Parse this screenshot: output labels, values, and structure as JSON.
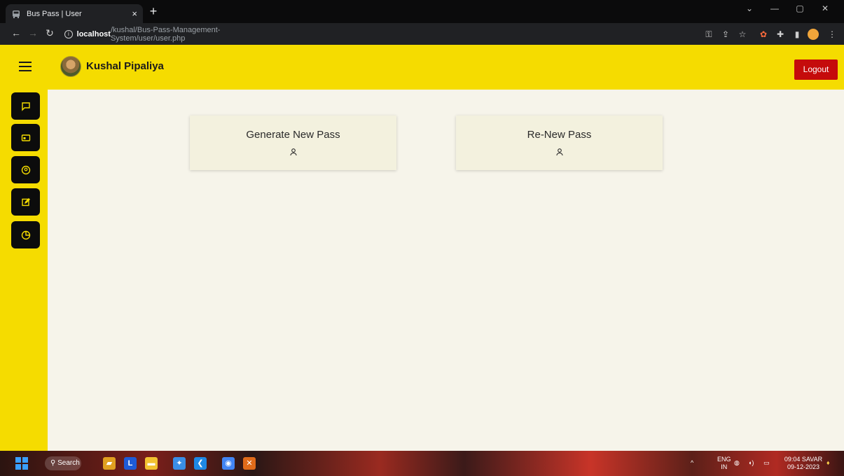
{
  "browser": {
    "tab_title": "Bus Pass | User",
    "tab_close": "×",
    "new_tab": "+",
    "url_host": "localhost",
    "url_path": "/kushal/Bus-Pass-Management-System/user/user.php",
    "window_controls": [
      "⌄",
      "—",
      "▢",
      "✕"
    ]
  },
  "header": {
    "user_name": "Kushal Pipaliya",
    "logout_label": "Logout"
  },
  "sidebar": {
    "items": [
      {
        "icon": "message-square-icon"
      },
      {
        "icon": "id-card-icon"
      },
      {
        "icon": "user-circle-icon"
      },
      {
        "icon": "edit-icon"
      },
      {
        "icon": "chart-pie-icon"
      }
    ]
  },
  "cards": [
    {
      "title": "Generate New Pass",
      "icon": "user-icon"
    },
    {
      "title": "Re-New Pass",
      "icon": "user-icon"
    }
  ],
  "taskbar": {
    "search_label": "Search",
    "lang_top": "ENG",
    "lang_bottom": "IN",
    "time": "09:04 SAVAR",
    "date": "09-12-2023"
  },
  "colors": {
    "accent_yellow": "#f5dc00",
    "logout_red": "#c50b0b",
    "content_bg": "#f6f4ea",
    "card_bg": "#f3f1de"
  }
}
